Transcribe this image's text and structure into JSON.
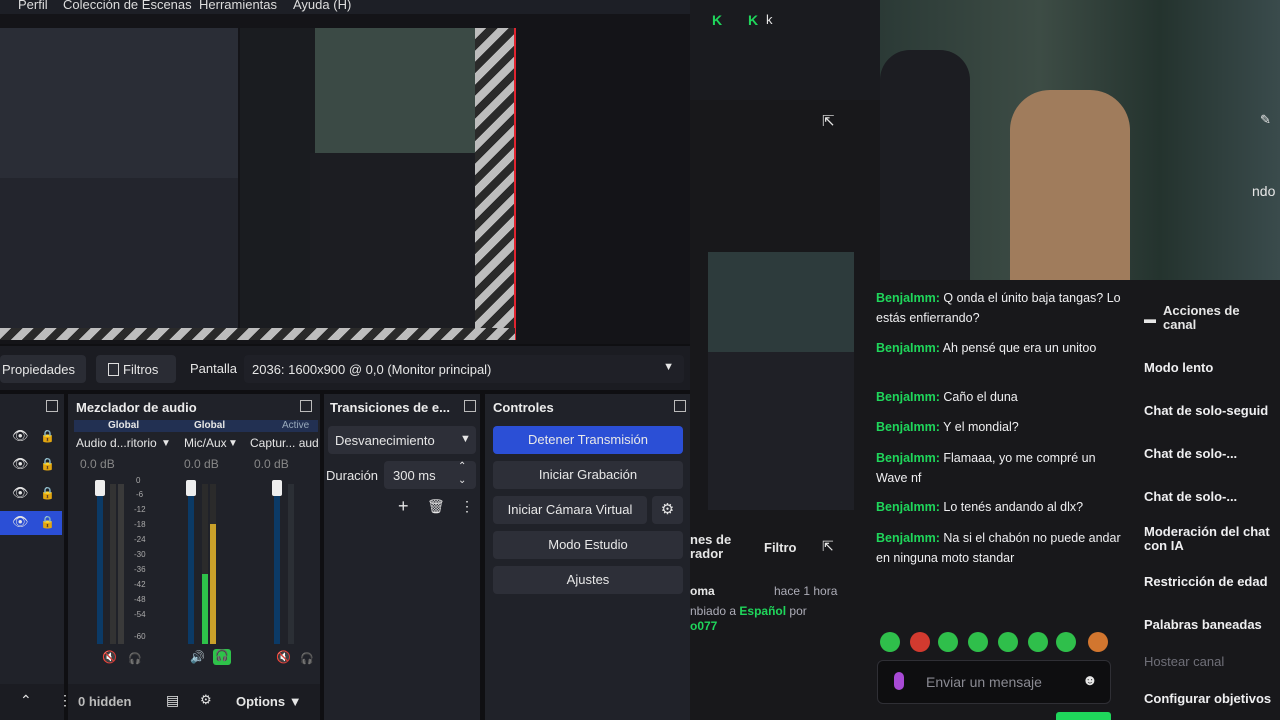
{
  "menu": [
    "Perfil",
    "Colección de Escenas",
    "Herramientas",
    "Ayuda (H)"
  ],
  "toolbar": {
    "properties": "Propiedades",
    "filters": "Filtros",
    "screen_label": "Pantalla",
    "screen_value": "2036: 1600x900 @ 0,0 (Monitor principal)"
  },
  "mixer": {
    "title": "Mezclador de audio",
    "channels": [
      {
        "tag": "Global",
        "name": "Audio d...ritorio",
        "db": "0.0 dB"
      },
      {
        "tag": "Global",
        "name": "Mic/Aux",
        "db": "0.0 dB"
      },
      {
        "tag": "Active",
        "name": "Captur... aud",
        "db": "0.0 dB"
      }
    ],
    "scale": [
      "0",
      "-6",
      "-12",
      "-18",
      "-24",
      "-30",
      "-36",
      "-42",
      "-48",
      "-54",
      "-60"
    ]
  },
  "transitions": {
    "title": "Transiciones de e...",
    "selected": "Desvanecimiento",
    "duration_label": "Duración",
    "duration_value": "300 ms"
  },
  "controls": {
    "title": "Controles",
    "stop_stream": "Detener Transmisión",
    "start_recording": "Iniciar Grabación",
    "virtual_cam": "Iniciar Cámara Virtual",
    "studio_mode": "Modo Estudio",
    "settings": "Ajustes"
  },
  "sources_footer": {
    "hidden": "0 hidden",
    "options": "Options"
  },
  "twitch": {
    "mod_title": "nes de\nrador",
    "filter": "Filtro",
    "log_user": "oma",
    "log_time": "hace 1 hora",
    "log_text": "nbiado a",
    "log_lang": "Español",
    "log_by": "por",
    "log_handle": "o077",
    "chat_placeholder": "Enviar un mensaje",
    "partial_right": "ndo",
    "partial_top": "k"
  },
  "chat": [
    {
      "user": "BenjaImm:",
      "text": "Q onda el únito baja tangas? Lo estás enfierrando?"
    },
    {
      "user": "BenjaImm:",
      "text": "Ah pensé que era un unitoo"
    },
    {
      "user": "BenjaImm:",
      "text": "Caño el duna"
    },
    {
      "user": "BenjaImm:",
      "text": "Y el mondial?"
    },
    {
      "user": "BenjaImm:",
      "text": "Flamaaa, yo me compré un Wave nf"
    },
    {
      "user": "BenjaImm:",
      "text": "Lo tenés andando al dlx?"
    },
    {
      "user": "BenjaImm:",
      "text": "Na si el chabón no puede andar en ninguna moto standar"
    }
  ],
  "actions": {
    "title": "Acciones de canal",
    "items": [
      "Modo lento",
      "Chat de solo-seguid",
      "Chat de solo-...",
      "Chat de solo-...",
      "Moderación del chat con IA",
      "Restricción de edad",
      "Palabras baneadas",
      "Hostear canal",
      "Configurar objetivos"
    ]
  },
  "colors": {
    "accent": "#2b4fd6",
    "twitch_green": "#1fd65b",
    "obs_bg": "#202229"
  }
}
